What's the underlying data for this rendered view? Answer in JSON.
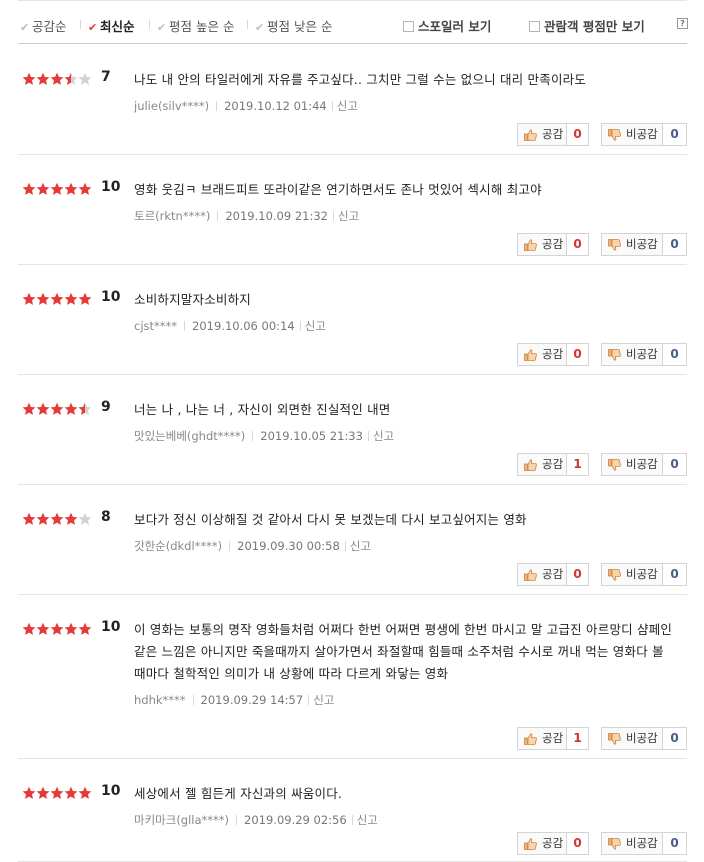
{
  "sort": {
    "options": [
      {
        "label": "공감순",
        "active": false
      },
      {
        "label": "최신순",
        "active": true
      },
      {
        "label": "평점 높은 순",
        "active": false
      },
      {
        "label": "평점 낮은 순",
        "active": false
      }
    ],
    "filters": [
      {
        "label": "스포일러 보기",
        "checked": false
      },
      {
        "label": "관람객 평점만 보기",
        "checked": false
      }
    ],
    "help_label": "?"
  },
  "buttons": {
    "like_label": "공감",
    "dislike_label": "비공감",
    "report_label": "신고"
  },
  "colors": {
    "star_on": "#e43a3a",
    "star_off": "#d3d3d3",
    "like_count": "#d13434",
    "dislike_count": "#4a5b86"
  },
  "reviews": [
    {
      "score": "7",
      "rating": 3.5,
      "text": "나도 내 안의 타일러에게 자유를 주고싶다.. 그치만 그럴 수는 없으니 대리 만족이라도",
      "author": "julie(silv****)",
      "date": "2019.10.12 01:44",
      "likes": "0",
      "dislikes": "0"
    },
    {
      "score": "10",
      "rating": 5,
      "text": "영화 웃김ㅋ 브래드피트 또라이같은 연기하면서도 존나 멋있어 섹시해 최고야",
      "author": "토르(rktn****)",
      "date": "2019.10.09 21:32",
      "likes": "0",
      "dislikes": "0"
    },
    {
      "score": "10",
      "rating": 5,
      "text": "소비하지말자소비하지",
      "author": "cjst****",
      "date": "2019.10.06 00:14",
      "likes": "0",
      "dislikes": "0"
    },
    {
      "score": "9",
      "rating": 4.5,
      "text": "너는 나 , 나는 너 , 자신이 외면한 진실적인 내면",
      "author": "맛있는베베(ghdt****)",
      "date": "2019.10.05 21:33",
      "likes": "1",
      "dislikes": "0"
    },
    {
      "score": "8",
      "rating": 4,
      "text": "보다가 정신 이상해질 것 같아서 다시 못 보겠는데 다시 보고싶어지는 영화",
      "author": "갓한순(dkdl****)",
      "date": "2019.09.30 00:58",
      "likes": "0",
      "dislikes": "0"
    },
    {
      "score": "10",
      "rating": 5,
      "text": "이 영화는 보통의 명작 영화들처럼 어쩌다 한번 어쩌면 평생에 한번 마시고 말 고급진 아르망디 샴페인같은 느낌은 아니지만 죽을때까지 살아가면서 좌절할때 힘들때 소주처럼 수시로 꺼내 먹는 영화다 볼때마다 철학적인 의미가 내 상황에 따라 다르게 와닿는 영화",
      "author": "hdhk****",
      "date": "2019.09.29 14:57",
      "likes": "1",
      "dislikes": "0"
    },
    {
      "score": "10",
      "rating": 5,
      "text": "세상에서 젤 힘든게 자신과의 싸움이다.",
      "author": "마키마크(glla****)",
      "date": "2019.09.29 02:56",
      "likes": "0",
      "dislikes": "0"
    }
  ]
}
